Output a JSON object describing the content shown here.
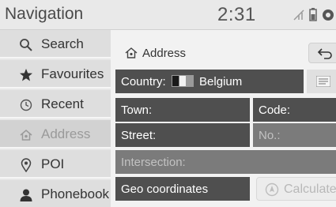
{
  "header": {
    "title": "Navigation",
    "clock": "2:31",
    "status_icons": [
      "no-signal-icon",
      "battery-icon",
      "connection-icon"
    ]
  },
  "sidebar": {
    "items": [
      {
        "label": "Search",
        "icon": "search-icon",
        "active": false
      },
      {
        "label": "Favourites",
        "icon": "star-icon",
        "active": false
      },
      {
        "label": "Recent",
        "icon": "clock-icon",
        "active": false
      },
      {
        "label": "Address",
        "icon": "home-icon",
        "active": true
      },
      {
        "label": "POI",
        "icon": "location-pin-icon",
        "active": false
      },
      {
        "label": "Phonebook",
        "icon": "person-icon",
        "active": false
      }
    ]
  },
  "main": {
    "title": "Address",
    "back_icon": "back-arrow-icon",
    "country": {
      "label": "Country:",
      "value": "Belgium",
      "flag": "belgium-flag-icon"
    },
    "list_icon": "list-icon",
    "fields": {
      "town": "Town:",
      "code": "Code:",
      "street": "Street:",
      "number": "No.:",
      "intersection": "Intersection:",
      "geo": "Geo coordinates"
    },
    "calculate": {
      "label": "Calculate",
      "icon": "calculate-icon",
      "enabled": false
    }
  }
}
